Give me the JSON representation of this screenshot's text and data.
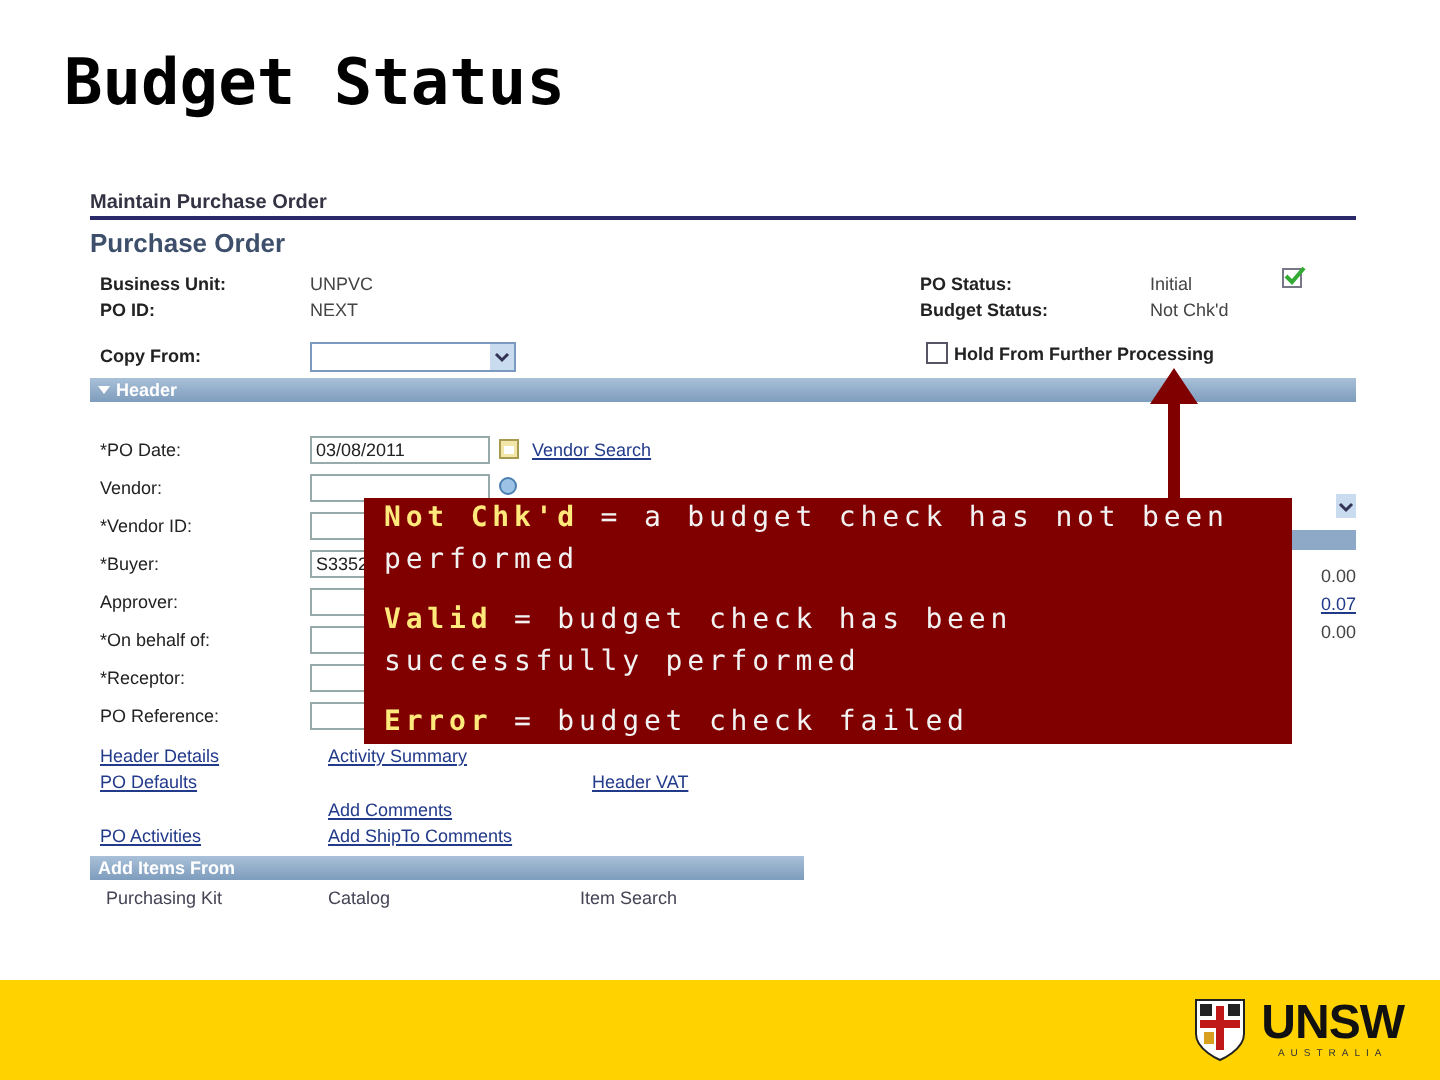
{
  "slide": {
    "title": "Budget Status"
  },
  "breadcrumb": "Maintain Purchase Order",
  "page_title": "Purchase Order",
  "summary_left": [
    {
      "label": "Business Unit:",
      "value": "UNPVC"
    },
    {
      "label": "PO ID:",
      "value": "NEXT"
    }
  ],
  "summary_right": [
    {
      "label": "PO Status:",
      "value": "Initial"
    },
    {
      "label": "Budget Status:",
      "value": "Not Chk'd"
    }
  ],
  "hold": {
    "label": "Hold From Further Processing",
    "checked": false
  },
  "copy_from": {
    "label": "Copy From:"
  },
  "header_section": {
    "title": "Header",
    "expanded": true
  },
  "header_fields": [
    {
      "label": "*PO Date:",
      "value": "03/08/2011",
      "kind": "date",
      "link": "Vendor Search"
    },
    {
      "label": "Vendor:",
      "kind": "lookup"
    },
    {
      "label": "*Vendor ID:"
    },
    {
      "label": "*Buyer:",
      "value": "S3352"
    },
    {
      "label": "Approver:"
    },
    {
      "label": "*On behalf of:"
    },
    {
      "label": "*Receptor:"
    },
    {
      "label": "PO Reference:"
    }
  ],
  "amounts": [
    {
      "text": "0.00",
      "kind": "text"
    },
    {
      "text": "0.07",
      "kind": "link"
    },
    {
      "text": "0.00",
      "kind": "text"
    }
  ],
  "link_rows": [
    {
      "left": "Header Details",
      "middle": "Activity Summary"
    },
    {
      "left": "PO Defaults",
      "right": "Header VAT"
    },
    {
      "middle": "Add Comments"
    },
    {
      "left": "PO Activities",
      "middle": "Add ShipTo Comments"
    }
  ],
  "add_items": {
    "title": "Add Items From",
    "options": [
      "Purchasing Kit",
      "Catalog",
      "Item Search"
    ]
  },
  "callout": {
    "lines": [
      "**Not Chk'd** = a budget check has not been performed",
      "**Valid** = budget check has been successfully performed",
      "**Error** = budget check failed"
    ]
  },
  "footer": {
    "logo_text": "UNSW",
    "logo_subtext": "AUSTRALIA"
  }
}
